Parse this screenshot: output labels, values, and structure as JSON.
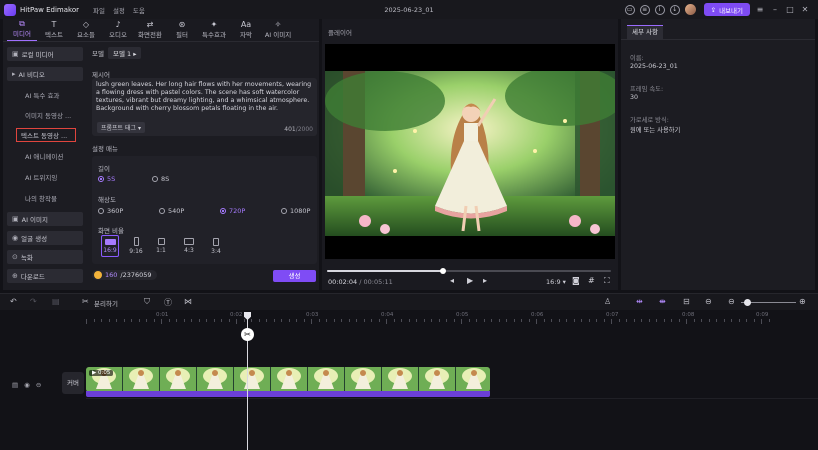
{
  "app": {
    "name": "HitPaw Edimakor",
    "menu": [
      "파일",
      "설정",
      "도움"
    ],
    "document_title": "2025-06-23_01",
    "export_label": "내보내기"
  },
  "toolbar": {
    "tabs": [
      {
        "label": "미디어",
        "icon": "media-icon"
      },
      {
        "label": "텍스트",
        "icon": "text-icon"
      },
      {
        "label": "요소들",
        "icon": "elements-icon"
      },
      {
        "label": "오디오",
        "icon": "audio-icon"
      },
      {
        "label": "화면전환",
        "icon": "transition-icon"
      },
      {
        "label": "필터",
        "icon": "filter-icon"
      },
      {
        "label": "특수효과",
        "icon": "effects-icon"
      },
      {
        "label": "자막",
        "icon": "subtitle-icon"
      },
      {
        "label": "AI 이미지",
        "icon": "ai-image-icon"
      }
    ],
    "active_tab": "미디어"
  },
  "sidebar": {
    "items": [
      {
        "label": "로컬 미디어",
        "type": "head"
      },
      {
        "label": "AI 비디오",
        "type": "head"
      },
      {
        "label": "AI 특수 효과",
        "type": "sub"
      },
      {
        "label": "이미지 동영상 ...",
        "type": "sub"
      },
      {
        "label": "텍스트 동영상 ...",
        "type": "selected"
      },
      {
        "label": "AI 애니메이션",
        "type": "sub"
      },
      {
        "label": "AI 트위지잉",
        "type": "sub"
      },
      {
        "label": "나의 창작물",
        "type": "sub"
      },
      {
        "label": "AI 이미지",
        "type": "head"
      },
      {
        "label": "얼굴 생성",
        "type": "head"
      },
      {
        "label": "녹화",
        "type": "head"
      },
      {
        "label": "다운로드",
        "type": "head"
      }
    ]
  },
  "content": {
    "model_label": "모델",
    "model_value": "모델 1",
    "prompt_label": "제시어",
    "prompt_text": "lush green leaves. Her long hair flows with her movements, wearing a flowing dress with pastel colors. The scene has soft watercolor textures, vibrant but dreamy lighting, and a whimsical atmosphere. Background with cherry blossom petals floating in the air.",
    "prompt_tag_label": "프롬프트 태그",
    "char_count": "401",
    "char_max": "/2000",
    "settings_label": "설정 매뉴",
    "length_label": "길이",
    "length_options": [
      "5S",
      "8S"
    ],
    "length_selected": "5S",
    "resolution_label": "해상도",
    "resolution_options": [
      "360P",
      "540P",
      "720P",
      "1080P"
    ],
    "resolution_selected": "720P",
    "ratio_label": "화면 비율",
    "ratio_options": [
      "16:9",
      "9:16",
      "1:1",
      "4:3",
      "3:4"
    ],
    "ratio_selected": "16:9",
    "credits_used": "160",
    "credits_total": "/2376059",
    "generate_label": "생성"
  },
  "player": {
    "title": "플레이어",
    "current_time": "00:02:04",
    "total_time": "/ 00:05:11",
    "progress": 0.41,
    "ratio_label": "16:9"
  },
  "properties": {
    "tab_label": "세부 사항",
    "fields": [
      {
        "label": "이름:",
        "value": "2025-06-23_01"
      },
      {
        "label": "프레임 속도:",
        "value": "30"
      },
      {
        "label": "가로세로 방식:",
        "value": "원에 또는 사용하기"
      }
    ]
  },
  "timeline": {
    "split_label": "분리하기",
    "cover_label": "커버",
    "clip_duration": "0:05",
    "ruler_labels": [
      "0:01",
      "0:02",
      "0:03",
      "0:04",
      "0:05",
      "0:06",
      "0:07",
      "0:08",
      "0:09"
    ],
    "playhead_time": "0:02"
  }
}
